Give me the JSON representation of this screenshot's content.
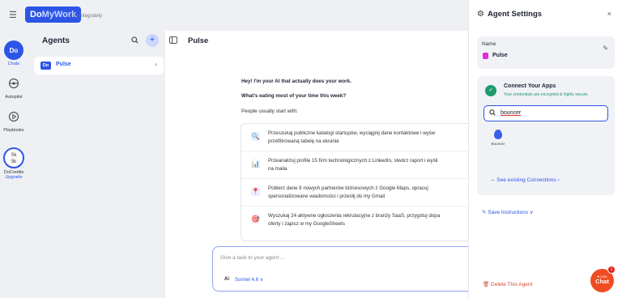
{
  "app": {
    "logo_do": "Do",
    "logo_mywork": "MyWork",
    "by": "by Integrately"
  },
  "rail": {
    "chats": "Chats",
    "chats_badge": "Do",
    "autopilot": "Autopilot",
    "playbooks": "Playbooks",
    "credits_top": "Sk",
    "credits_bot": "5k",
    "docredits": "DoCredits",
    "upgrade": "Upgrade"
  },
  "agents": {
    "title": "Agents",
    "add": "+",
    "items": [
      {
        "badge": "Do",
        "name": "Pulse"
      }
    ]
  },
  "main": {
    "title": "Pulse",
    "greeting": "Hey! I'm your AI that actually does your work.",
    "question": "What's eating most of your time this week?",
    "prompt": "People usually start with:",
    "suggestions": [
      {
        "icon": "🔍",
        "line1": "Przeszukaj publiczne katalogi startupów, wyciągnij dane kontaktowe i wyśw",
        "line2": "przefiltrowaną tabelę na ekranie"
      },
      {
        "icon": "📊",
        "line1": "Przeanalizuj profile 15 firm technologicznych z LinkedIn, stwórz raport i wyśli",
        "line2": "na maila"
      },
      {
        "icon": "📍",
        "line1": "Pobierz dane 8 nowych partnerów biznesowych z Google Maps, opracuj",
        "line2": "spersonalizowane wiadomości i prześlij do my Gmail"
      },
      {
        "icon": "🎯",
        "line1": "Wyszukaj 24 aktywne ogłoszenia rekrutacyjne z branży SaaS, przygotuj dopa",
        "line2": "oferty i zapisz w my GoogleSheets"
      }
    ],
    "task_placeholder": "Give a task to your agent ...",
    "model_icon": "A\\",
    "model": "Sonnet 4.6 ∨"
  },
  "settings": {
    "title": "Agent Settings",
    "close": "×",
    "name_label": "Name",
    "name_value": "Pulse",
    "agent_color": "#e62ad7",
    "connect_title": "Connect Your Apps",
    "connect_sub": "Your credentials are encrypted & highly secure.",
    "search_value": "bouncer",
    "app_name": "Bouncer",
    "see_connections": "⇔ See existing Connections  ›",
    "save_instructions": "✎ Save Instructions  ∨",
    "delete": "🗑 Delete This Agent"
  },
  "live_chat": {
    "top": "● Live",
    "bottom": "Chat",
    "badge": "1"
  }
}
